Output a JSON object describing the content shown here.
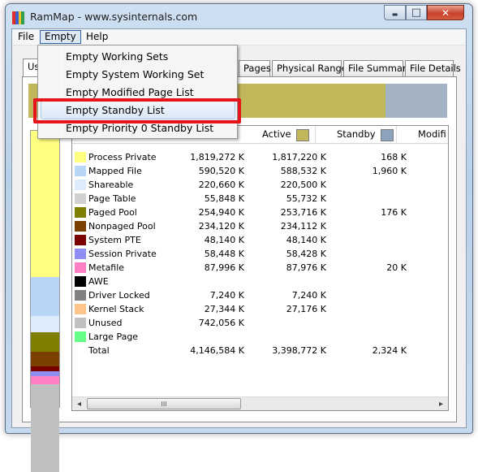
{
  "window": {
    "title": "RamMap - www.sysinternals.com",
    "min_glyph": "▬",
    "max_glyph": "□",
    "close_glyph": "✕",
    "app_icon_colors": [
      "#e0302a",
      "#3a60d0",
      "#f0c020",
      "#30a050"
    ]
  },
  "menubar": {
    "items": [
      "File",
      "Empty",
      "Help"
    ]
  },
  "empty_menu": {
    "items": [
      "Empty Working Sets",
      "Empty System Working Set",
      "Empty Modified Page List",
      "Empty Standby List",
      "Empty Priority 0 Standby List"
    ],
    "highlighted": "Empty Standby List"
  },
  "tabs": {
    "items": [
      "Use",
      "Pages",
      "Physical Ranges",
      "File Summary",
      "File Details"
    ],
    "visible_fragments": [
      "Us",
      "Pages",
      "Physical Ranges",
      "File Summary",
      "File Details"
    ],
    "selected": "Use"
  },
  "top_bar": {
    "colors": [
      "#c0b75a",
      "#a3b3c3"
    ]
  },
  "left_bar": {
    "colors": [
      "#ffff80",
      "#b7d6f7",
      "#dcecfc",
      "#7e7e00",
      "#7b3f00",
      "#7a0000",
      "#8e8ef5",
      "#ff7fc2",
      "#c0c0c0"
    ]
  },
  "list": {
    "columns": [
      "Active",
      "Standby",
      "Modified"
    ],
    "column_header_fragments": [
      "Active",
      "Standby",
      "Modifi"
    ],
    "column_colors": {
      "active": "#c0b75a",
      "standby": "#8da3bd"
    },
    "rows": [
      {
        "label": "Process Private",
        "color": "#ffff80",
        "total": "1,819,272 K",
        "active": "1,817,220 K",
        "standby": "168 K"
      },
      {
        "label": "Mapped File",
        "color": "#b7d6f7",
        "total": "590,520 K",
        "active": "588,532 K",
        "standby": "1,960 K"
      },
      {
        "label": "Shareable",
        "color": "#dcecfc",
        "total": "220,660 K",
        "active": "220,500 K",
        "standby": ""
      },
      {
        "label": "Page Table",
        "color": "#d0d0d0",
        "total": "55,848 K",
        "active": "55,732 K",
        "standby": ""
      },
      {
        "label": "Paged Pool",
        "color": "#7e7e00",
        "total": "254,940 K",
        "active": "253,716 K",
        "standby": "176 K"
      },
      {
        "label": "Nonpaged Pool",
        "color": "#7b3f00",
        "total": "234,120 K",
        "active": "234,112 K",
        "standby": ""
      },
      {
        "label": "System PTE",
        "color": "#7a0000",
        "total": "48,140 K",
        "active": "48,140 K",
        "standby": ""
      },
      {
        "label": "Session Private",
        "color": "#8e8ef5",
        "total": "58,448 K",
        "active": "58,428 K",
        "standby": ""
      },
      {
        "label": "Metafile",
        "color": "#ff7fc2",
        "total": "87,996 K",
        "active": "87,976 K",
        "standby": "20 K"
      },
      {
        "label": "AWE",
        "color": "#000000",
        "total": "",
        "active": "",
        "standby": ""
      },
      {
        "label": "Driver Locked",
        "color": "#808080",
        "total": "7,240 K",
        "active": "7,240 K",
        "standby": ""
      },
      {
        "label": "Kernel Stack",
        "color": "#ffc48a",
        "total": "27,344 K",
        "active": "27,176 K",
        "standby": ""
      },
      {
        "label": "Unused",
        "color": "#c0c0c0",
        "total": "742,056 K",
        "active": "",
        "standby": ""
      },
      {
        "label": "Large Page",
        "color": "#66ff88",
        "total": "",
        "active": "",
        "standby": ""
      },
      {
        "label": "Total",
        "color": "",
        "total": "4,146,584 K",
        "active": "3,398,772 K",
        "standby": "2,324 K"
      }
    ]
  },
  "scrollbar": {
    "left_arrow": "◂",
    "right_arrow": "▸",
    "grip": "III"
  },
  "annotation": {
    "color": "#e8141c"
  }
}
